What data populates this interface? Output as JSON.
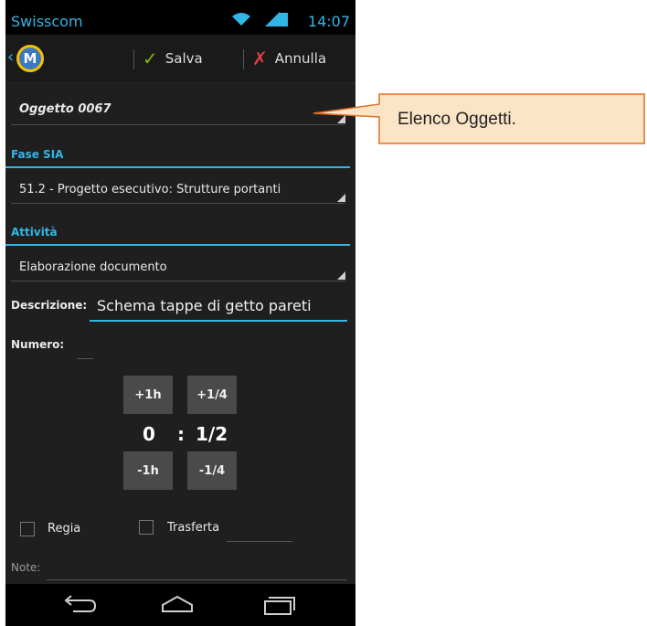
{
  "status_bar": {
    "carrier": "Swisscom",
    "time": "14:07"
  },
  "action_bar": {
    "save_label": "Salva",
    "cancel_label": "Annulla",
    "logo_letter": "M"
  },
  "form": {
    "oggetto": "Oggetto 0067",
    "fase_label": "Fase SIA",
    "fase_value": "51.2 - Progetto esecutivo: Strutture portanti",
    "attivita_label": "Attività",
    "attivita_value": "Elaborazione documento",
    "descrizione_label": "Descrizione:",
    "descrizione_value": "Schema tappe di getto pareti",
    "numero_label": "Numero:",
    "numero_value": ""
  },
  "time_picker": {
    "plus_hour": "+1h",
    "plus_quarter": "+1/4",
    "minus_hour": "-1h",
    "minus_quarter": "-1/4",
    "hours": "0",
    "separator": ":",
    "fraction": "1/2"
  },
  "options": {
    "regia_label": "Regia",
    "regia_checked": false,
    "trasferta_label": "Trasferta",
    "trasferta_checked": false,
    "trasferta_value": ""
  },
  "note": {
    "label": "Note:",
    "value": ""
  },
  "annotation": {
    "text": "Elenco Oggetti."
  },
  "colors": {
    "accent": "#33b5e5",
    "background": "#1f1f1f",
    "callout_fill": "#fce4c7",
    "callout_border": "#e07020"
  }
}
